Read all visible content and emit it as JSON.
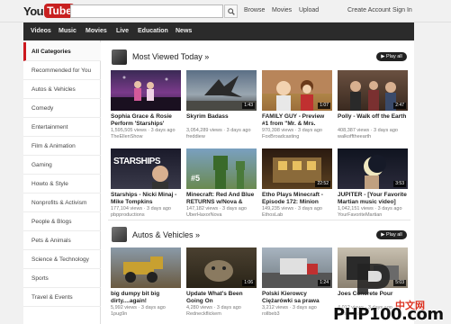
{
  "header": {
    "logo_you": "You",
    "logo_tube": "Tube",
    "search_placeholder": "",
    "links": [
      "Browse",
      "Movies",
      "Upload"
    ],
    "account_links": [
      "Create Account",
      "Sign In"
    ]
  },
  "nav": {
    "items": [
      "Videos",
      "Music",
      "Movies",
      "Live",
      "Education",
      "News"
    ]
  },
  "sidebar": {
    "items": [
      "All Categories",
      "Recommended for You",
      "Autos & Vehicles",
      "Comedy",
      "Entertainment",
      "Film & Animation",
      "Gaming",
      "Howto & Style",
      "Nonprofits & Activism",
      "People & Blogs",
      "Pets & Animals",
      "Science & Technology",
      "Sports",
      "Travel & Events"
    ]
  },
  "sections": [
    {
      "title": "Most Viewed Today »",
      "play_all": "Play all",
      "videos": [
        {
          "title": "Sophia Grace & Rosie Perform 'Starships'",
          "meta": "1,595,505 views · 3 days ago",
          "channel": "TheEllenShow",
          "duration": "",
          "thumb_overlay": ""
        },
        {
          "title": "Skyrim Badass",
          "meta": "3,054,289 views · 3 days ago",
          "channel": "freddiew",
          "duration": "1:43",
          "thumb_overlay": ""
        },
        {
          "title": "FAMILY GUY - Preview #1 from \"Mr. & Mrs. Stewie\"",
          "meta": "970,398 views · 3 days ago",
          "channel": "FoxBroadcasting",
          "duration": "1:07",
          "thumb_overlay": ""
        },
        {
          "title": "Polly - Walk off the Earth",
          "meta": "408,387 views · 3 days ago",
          "channel": "walkofftheearth",
          "duration": "2:47",
          "thumb_overlay": ""
        },
        {
          "title": "Starships - Nicki Minaj - Mike Tompkins",
          "meta": "177,104 views · 3 days ago",
          "channel": "pbpproductions",
          "duration": "",
          "thumb_overlay": "STARSHIPS"
        },
        {
          "title": "Minecraft: Red And Blue RETURNS w/Nova & Kevin",
          "meta": "147,182 views · 3 days ago",
          "channel": "UberHaxorNova",
          "duration": "",
          "thumb_overlay": "#5"
        },
        {
          "title": "Etho Plays Minecraft - Episode 172: Minion",
          "meta": "149,235 views · 3 days ago",
          "channel": "EthosLab",
          "duration": "22:52",
          "thumb_overlay": ""
        },
        {
          "title": "JUPITER - [Your Favorite Martian music video]",
          "meta": "1,042,151 views · 3 days ago",
          "channel": "YourFavoriteMartian",
          "duration": "3:53",
          "thumb_overlay": ""
        }
      ]
    },
    {
      "title": "Autos & Vehicles »",
      "play_all": "Play all",
      "videos": [
        {
          "title": "big dumpy bit big dirty....again!",
          "meta": "5,992 views · 3 days ago",
          "channel": "1pug9n",
          "duration": "",
          "thumb_overlay": ""
        },
        {
          "title": "Update What's Been Going On",
          "meta": "4,280 views · 3 days ago",
          "channel": "Redneckflickem",
          "duration": "1:06",
          "thumb_overlay": ""
        },
        {
          "title": "Polski Kierowcy Ciężarówki sa prawa część 38 - Droga",
          "meta": "3,212 views · 3 days ago",
          "channel": "rollbeb3",
          "duration": "1:24",
          "thumb_overlay": ""
        },
        {
          "title": "Joes Concrete Pour",
          "meta": "4,012 views · 3 days ago",
          "channel": "joesquickmix",
          "duration": "5:03",
          "thumb_overlay": ""
        }
      ]
    }
  ],
  "watermark": {
    "text": "PHP100.com",
    "cn": "中文网"
  },
  "colors": {
    "accent": "#cc181e",
    "nav_bg": "#2b2b2b",
    "page_bg": "#f1f1f1"
  }
}
